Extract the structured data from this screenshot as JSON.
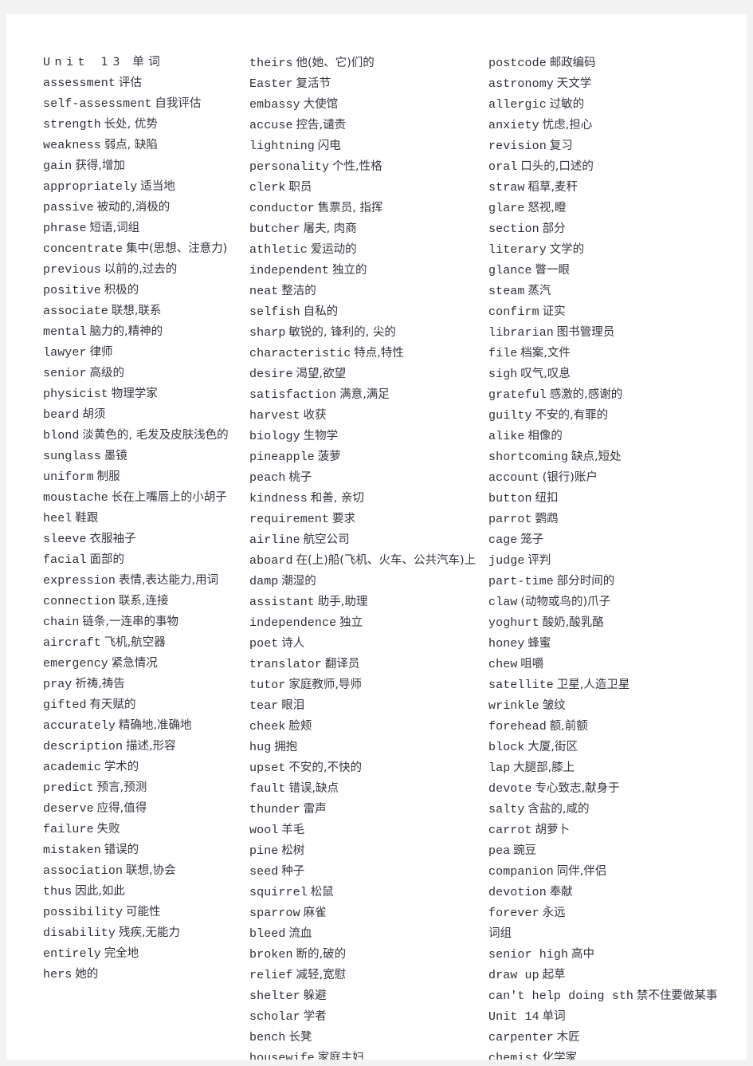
{
  "document": {
    "title": "Unit 13 单词",
    "page_background": "#ffffff",
    "canvas_background": "#f2f2f2",
    "text_color": "#2d2d38",
    "column_count": 3
  },
  "columns": [
    {
      "id": "column-1",
      "entries": [
        {
          "kind": "heading",
          "term": "Unit",
          "gloss": "13 单词",
          "spaced": "U n i t   1 3  单 词"
        },
        {
          "kind": "word",
          "term": "assessment",
          "gloss": "评估"
        },
        {
          "kind": "word",
          "term": "self-assessment",
          "gloss": "自我评估"
        },
        {
          "kind": "word",
          "term": "strength",
          "gloss": "长处, 优势"
        },
        {
          "kind": "word",
          "term": "weakness",
          "gloss": "弱点, 缺陷"
        },
        {
          "kind": "word",
          "term": "gain",
          "gloss": "获得,增加"
        },
        {
          "kind": "word",
          "term": "appropriately",
          "gloss": "适当地"
        },
        {
          "kind": "word",
          "term": "passive",
          "gloss": "被动的,消极的"
        },
        {
          "kind": "word",
          "term": "phrase",
          "gloss": "短语,词组"
        },
        {
          "kind": "word",
          "term": "concentrate",
          "gloss": "集中(思想、注意力)"
        },
        {
          "kind": "word",
          "term": "previous",
          "gloss": "以前的,过去的"
        },
        {
          "kind": "word",
          "term": "positive",
          "gloss": "积极的"
        },
        {
          "kind": "word",
          "term": "associate",
          "gloss": "联想,联系"
        },
        {
          "kind": "word",
          "term": "mental",
          "gloss": "脑力的,精神的"
        },
        {
          "kind": "word",
          "term": "lawyer",
          "gloss": "律师"
        },
        {
          "kind": "word",
          "term": "senior",
          "gloss": "高级的"
        },
        {
          "kind": "word",
          "term": "physicist",
          "gloss": "物理学家"
        },
        {
          "kind": "word",
          "term": "beard",
          "gloss": "胡须"
        },
        {
          "kind": "word",
          "term": "blond",
          "gloss": "淡黄色的, 毛发及皮肤浅色的"
        },
        {
          "kind": "word",
          "term": "sunglass",
          "gloss": "墨镜"
        },
        {
          "kind": "word",
          "term": "uniform",
          "gloss": "制服"
        },
        {
          "kind": "word",
          "term": "moustache",
          "gloss": "长在上嘴唇上的小胡子"
        },
        {
          "kind": "word",
          "term": "heel",
          "gloss": "鞋跟"
        },
        {
          "kind": "word",
          "term": "sleeve",
          "gloss": "衣服袖子"
        },
        {
          "kind": "word",
          "term": "facial",
          "gloss": "面部的"
        },
        {
          "kind": "word",
          "term": "expression",
          "gloss": "表情,表达能力,用词"
        },
        {
          "kind": "word",
          "term": "connection",
          "gloss": "联系,连接"
        },
        {
          "kind": "word",
          "term": "chain",
          "gloss": "链条,一连串的事物"
        },
        {
          "kind": "word",
          "term": "aircraft",
          "gloss": "飞机,航空器"
        },
        {
          "kind": "word",
          "term": "emergency",
          "gloss": "紧急情况"
        },
        {
          "kind": "word",
          "term": "pray",
          "gloss": "祈祷,祷告"
        },
        {
          "kind": "word",
          "term": "gifted",
          "gloss": "有天赋的"
        },
        {
          "kind": "word",
          "term": "accurately",
          "gloss": "精确地,准确地"
        },
        {
          "kind": "word",
          "term": "description",
          "gloss": "描述,形容"
        },
        {
          "kind": "word",
          "term": "academic",
          "gloss": "学术的"
        },
        {
          "kind": "word",
          "term": "predict",
          "gloss": "预言,预测"
        },
        {
          "kind": "word",
          "term": "deserve",
          "gloss": "应得,值得"
        },
        {
          "kind": "word",
          "term": "failure",
          "gloss": "失败"
        },
        {
          "kind": "word",
          "term": "mistaken",
          "gloss": "错误的"
        },
        {
          "kind": "word",
          "term": "association",
          "gloss": "联想,协会"
        },
        {
          "kind": "word",
          "term": "thus",
          "gloss": "因此,如此"
        },
        {
          "kind": "word",
          "term": "possibility",
          "gloss": "可能性"
        },
        {
          "kind": "word",
          "term": "disability",
          "gloss": "残疾,无能力"
        },
        {
          "kind": "word",
          "term": "entirely",
          "gloss": "完全地"
        },
        {
          "kind": "word",
          "term": "hers",
          "gloss": "她的"
        }
      ]
    },
    {
      "id": "column-2",
      "entries": [
        {
          "kind": "word",
          "term": "theirs",
          "gloss": "他(她、它)们的"
        },
        {
          "kind": "word",
          "term": "Easter",
          "gloss": "复活节"
        },
        {
          "kind": "word",
          "term": "embassy",
          "gloss": "大使馆"
        },
        {
          "kind": "word",
          "term": "accuse",
          "gloss": "控告,谴责"
        },
        {
          "kind": "word",
          "term": "lightning",
          "gloss": "闪电"
        },
        {
          "kind": "word",
          "term": "personality",
          "gloss": "个性,性格"
        },
        {
          "kind": "word",
          "term": "clerk",
          "gloss": "职员"
        },
        {
          "kind": "word",
          "term": "conductor",
          "gloss": "售票员, 指挥"
        },
        {
          "kind": "word",
          "term": "butcher",
          "gloss": "屠夫, 肉商"
        },
        {
          "kind": "word",
          "term": "athletic",
          "gloss": "爱运动的"
        },
        {
          "kind": "word",
          "term": "independent",
          "gloss": "独立的"
        },
        {
          "kind": "word",
          "term": "neat",
          "gloss": "整洁的"
        },
        {
          "kind": "word",
          "term": "selfish",
          "gloss": "自私的"
        },
        {
          "kind": "word",
          "term": "sharp",
          "gloss": "敏锐的, 锋利的, 尖的"
        },
        {
          "kind": "word",
          "term": "characteristic",
          "gloss": "特点,特性"
        },
        {
          "kind": "word",
          "term": "desire",
          "gloss": "渴望,欲望"
        },
        {
          "kind": "word",
          "term": "satisfaction",
          "gloss": "满意,满足"
        },
        {
          "kind": "word",
          "term": "harvest",
          "gloss": "收获"
        },
        {
          "kind": "word",
          "term": "biology",
          "gloss": "生物学"
        },
        {
          "kind": "word",
          "term": "pineapple",
          "gloss": "菠萝"
        },
        {
          "kind": "word",
          "term": "peach",
          "gloss": "桃子"
        },
        {
          "kind": "word",
          "term": "kindness",
          "gloss": "和善, 亲切"
        },
        {
          "kind": "word",
          "term": "requirement",
          "gloss": "要求"
        },
        {
          "kind": "word",
          "term": "airline",
          "gloss": "航空公司"
        },
        {
          "kind": "word",
          "term": "aboard",
          "gloss": "在(上)船(飞机、火车、公共汽车)上"
        },
        {
          "kind": "word",
          "term": "damp",
          "gloss": "潮湿的"
        },
        {
          "kind": "word",
          "term": "assistant",
          "gloss": "助手,助理"
        },
        {
          "kind": "word",
          "term": "independence",
          "gloss": "独立"
        },
        {
          "kind": "word",
          "term": "poet",
          "gloss": "诗人"
        },
        {
          "kind": "word",
          "term": "translator",
          "gloss": "翻译员"
        },
        {
          "kind": "word",
          "term": "tutor",
          "gloss": "家庭教师,导师"
        },
        {
          "kind": "word",
          "term": "tear",
          "gloss": "眼泪"
        },
        {
          "kind": "word",
          "term": "cheek",
          "gloss": "脸颊"
        },
        {
          "kind": "word",
          "term": "hug",
          "gloss": "拥抱"
        },
        {
          "kind": "word",
          "term": "upset",
          "gloss": "不安的,不快的"
        },
        {
          "kind": "word",
          "term": "fault",
          "gloss": "错误,缺点"
        },
        {
          "kind": "word",
          "term": "thunder",
          "gloss": "雷声"
        },
        {
          "kind": "word",
          "term": "wool",
          "gloss": "羊毛"
        },
        {
          "kind": "word",
          "term": "pine",
          "gloss": "松树"
        },
        {
          "kind": "word",
          "term": "seed",
          "gloss": "种子"
        },
        {
          "kind": "word",
          "term": "squirrel",
          "gloss": "松鼠"
        },
        {
          "kind": "word",
          "term": "sparrow",
          "gloss": "麻雀"
        },
        {
          "kind": "word",
          "term": "bleed",
          "gloss": "流血"
        },
        {
          "kind": "word",
          "term": "broken",
          "gloss": "断的,破的"
        },
        {
          "kind": "word",
          "term": "relief",
          "gloss": "减轻,宽慰"
        },
        {
          "kind": "word",
          "term": "shelter",
          "gloss": "躲避"
        },
        {
          "kind": "word",
          "term": "scholar",
          "gloss": "学者"
        },
        {
          "kind": "word",
          "term": "bench",
          "gloss": "长凳"
        },
        {
          "kind": "word",
          "term": "housewife",
          "gloss": "家庭主妇"
        }
      ]
    },
    {
      "id": "column-3",
      "entries": [
        {
          "kind": "word",
          "term": "postcode",
          "gloss": "邮政编码"
        },
        {
          "kind": "word",
          "term": "astronomy",
          "gloss": "天文学"
        },
        {
          "kind": "word",
          "term": "allergic",
          "gloss": "过敏的"
        },
        {
          "kind": "word",
          "term": "anxiety",
          "gloss": "忧虑,担心"
        },
        {
          "kind": "word",
          "term": "revision",
          "gloss": "复习"
        },
        {
          "kind": "word",
          "term": "oral",
          "gloss": "口头的,口述的"
        },
        {
          "kind": "word",
          "term": "straw",
          "gloss": "稻草,麦秆"
        },
        {
          "kind": "word",
          "term": "glare",
          "gloss": "怒视,瞪"
        },
        {
          "kind": "word",
          "term": "section",
          "gloss": "部分"
        },
        {
          "kind": "word",
          "term": "literary",
          "gloss": "文学的"
        },
        {
          "kind": "word",
          "term": "glance",
          "gloss": "瞥一眼"
        },
        {
          "kind": "word",
          "term": "steam",
          "gloss": "蒸汽"
        },
        {
          "kind": "word",
          "term": "confirm",
          "gloss": "证实"
        },
        {
          "kind": "word",
          "term": "librarian",
          "gloss": "图书管理员"
        },
        {
          "kind": "word",
          "term": "file",
          "gloss": "档案,文件"
        },
        {
          "kind": "word",
          "term": "sigh",
          "gloss": "叹气,叹息"
        },
        {
          "kind": "word",
          "term": "grateful",
          "gloss": "感激的,感谢的"
        },
        {
          "kind": "word",
          "term": "guilty",
          "gloss": "不安的,有罪的"
        },
        {
          "kind": "word",
          "term": "alike",
          "gloss": "相像的"
        },
        {
          "kind": "word",
          "term": "shortcoming",
          "gloss": "缺点,短处"
        },
        {
          "kind": "word",
          "term": "account",
          "gloss": "(银行)账户"
        },
        {
          "kind": "word",
          "term": "button",
          "gloss": "纽扣"
        },
        {
          "kind": "word",
          "term": "parrot",
          "gloss": "鹦鹉"
        },
        {
          "kind": "word",
          "term": "cage",
          "gloss": "笼子"
        },
        {
          "kind": "word",
          "term": "judge",
          "gloss": "评判"
        },
        {
          "kind": "word",
          "term": "part-time",
          "gloss": "部分时间的"
        },
        {
          "kind": "word",
          "term": "claw",
          "gloss": "(动物或鸟的)爪子"
        },
        {
          "kind": "word",
          "term": "yoghurt",
          "gloss": "酸奶,酸乳酪"
        },
        {
          "kind": "word",
          "term": "honey",
          "gloss": "蜂蜜"
        },
        {
          "kind": "word",
          "term": "chew",
          "gloss": "咀嚼"
        },
        {
          "kind": "word",
          "term": "satellite",
          "gloss": "卫星,人造卫星"
        },
        {
          "kind": "word",
          "term": "wrinkle",
          "gloss": "皱纹"
        },
        {
          "kind": "word",
          "term": "forehead",
          "gloss": "额,前额"
        },
        {
          "kind": "word",
          "term": "block",
          "gloss": "大厦,街区"
        },
        {
          "kind": "word",
          "term": "lap",
          "gloss": "大腿部,膝上"
        },
        {
          "kind": "word",
          "term": "devote",
          "gloss": "专心致志,献身于"
        },
        {
          "kind": "word",
          "term": "salty",
          "gloss": "含盐的,咸的"
        },
        {
          "kind": "word",
          "term": "carrot",
          "gloss": "胡萝卜"
        },
        {
          "kind": "word",
          "term": "pea",
          "gloss": "豌豆"
        },
        {
          "kind": "word",
          "term": "companion",
          "gloss": "同伴,伴侣"
        },
        {
          "kind": "word",
          "term": "devotion",
          "gloss": "奉献"
        },
        {
          "kind": "word",
          "term": "forever",
          "gloss": "永远"
        },
        {
          "kind": "word",
          "term": "",
          "gloss": "词组"
        },
        {
          "kind": "word",
          "term": "senior high",
          "gloss": "高中"
        },
        {
          "kind": "word",
          "term": "draw up",
          "gloss": "起草"
        },
        {
          "kind": "word",
          "term": "can't help doing sth",
          "gloss": "禁不住要做某事"
        },
        {
          "kind": "word",
          "term": "Unit 14",
          "gloss": "单词"
        },
        {
          "kind": "word",
          "term": "carpenter",
          "gloss": "木匠"
        },
        {
          "kind": "word",
          "term": "chemist",
          "gloss": "化学家"
        }
      ]
    }
  ]
}
